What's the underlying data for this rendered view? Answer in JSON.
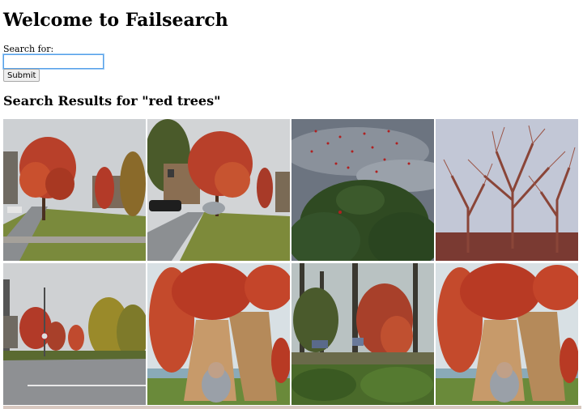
{
  "page": {
    "title": "Welcome to Failsearch",
    "search_label": "Search for:",
    "search_value": "",
    "submit_label": "Submit",
    "results_heading": "Search Results for \"red trees\""
  },
  "results": [
    {
      "subject": "red tree on street corner"
    },
    {
      "subject": "red tree by houses with car"
    },
    {
      "subject": "birds over dark tree"
    },
    {
      "subject": "bare red branches"
    },
    {
      "subject": "autumn trees by road"
    },
    {
      "subject": "giant red mushroom sculpture"
    },
    {
      "subject": "red tree in woods"
    },
    {
      "subject": "giant red mushroom sculpture"
    }
  ],
  "colors": {
    "focus_border": "#56a0e8",
    "foliage_red": "#c0432a",
    "grass": "#8a9a4a",
    "sky": "#c9ccd0"
  }
}
